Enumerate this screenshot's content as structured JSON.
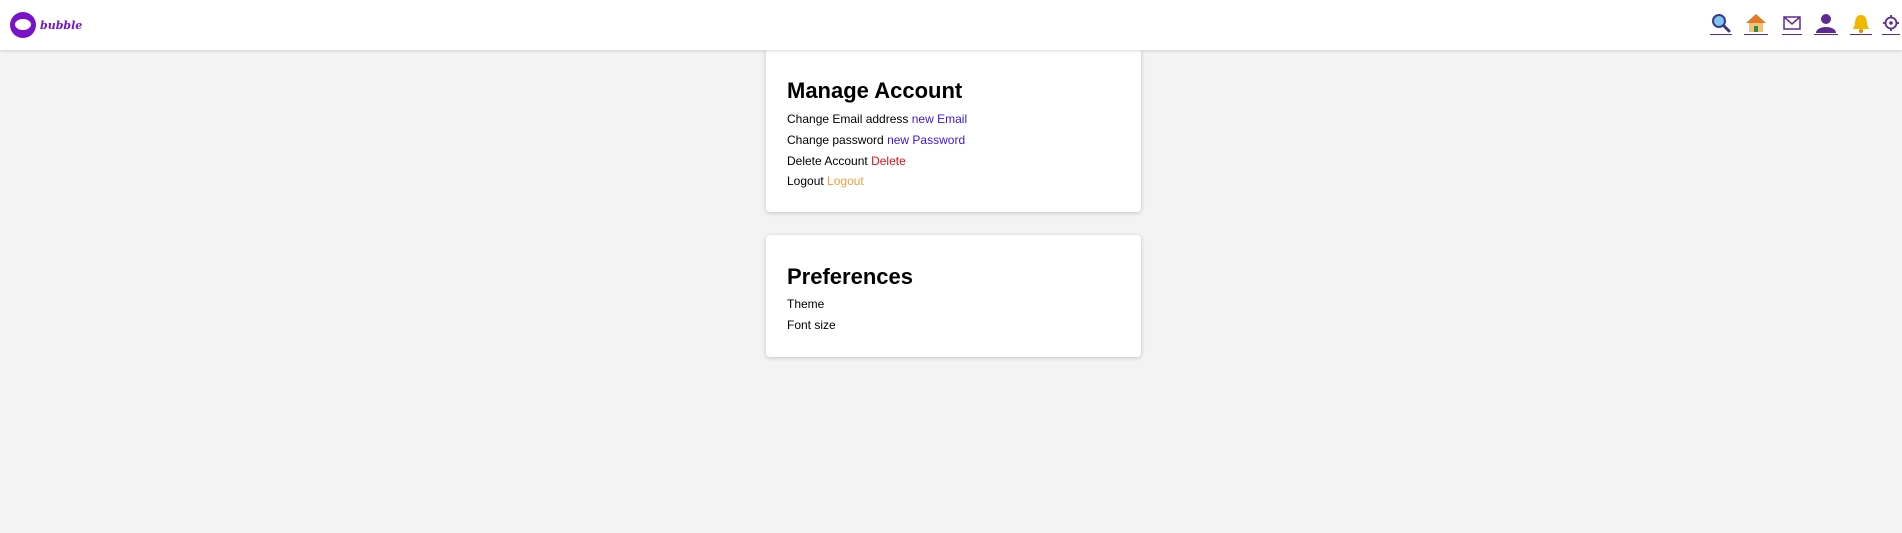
{
  "brand": {
    "name": "bubble",
    "color": "#7a12c9"
  },
  "nav": {
    "icons": [
      "search-icon",
      "home-icon",
      "mail-icon",
      "profile-icon",
      "notifications-icon",
      "settings-icon"
    ]
  },
  "manage_account": {
    "title": "Manage Account",
    "rows": [
      {
        "label": "Change Email address",
        "action": "new Email",
        "action_color": "#3c15e0"
      },
      {
        "label": "Change password",
        "action": "new Password",
        "action_color": "#3c15e0"
      },
      {
        "label": "Delete Account",
        "action": "Delete",
        "action_color": "#e0101c"
      },
      {
        "label": "Logout",
        "action": "Logout",
        "action_color": "#f0a03c"
      }
    ]
  },
  "preferences": {
    "title": "Preferences",
    "items": [
      "Theme",
      "Font size"
    ]
  }
}
